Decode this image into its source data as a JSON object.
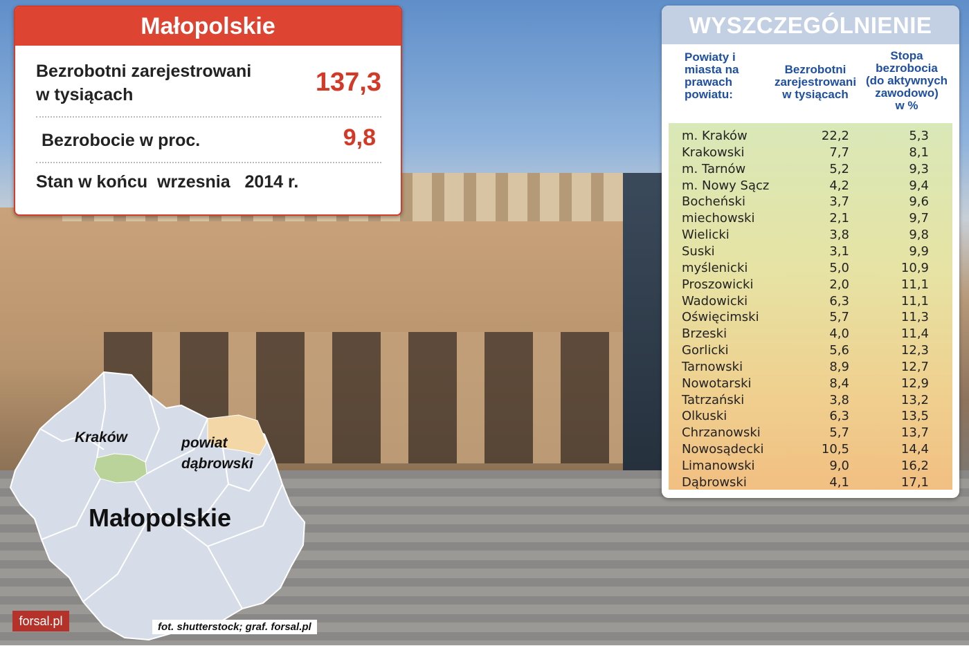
{
  "summary": {
    "title": "Małopolskie",
    "registered_label_line1": "Bezrobotni zarejestrowani",
    "registered_label_line2": "w tysiącach",
    "registered_value": "137,3",
    "rate_label": "Bezrobocie w proc.",
    "rate_value": "9,8",
    "status_label": "Stan w końcu  wrzesnia   2014 r."
  },
  "table": {
    "title": "WYSZCZEGÓLNIENIE",
    "headers": {
      "col1": [
        "Powiaty i",
        "miasta na",
        "prawach",
        "powiatu:"
      ],
      "col2": [
        "Bezrobotni",
        "zarejestrowani",
        "w tysiącach"
      ],
      "col3": [
        "Stopa",
        "bezrobocia",
        "(do aktywnych",
        "zawodowo)",
        "w %"
      ]
    },
    "rows": [
      {
        "name": "m. Kraków",
        "registered": "22,2",
        "rate": "5,3"
      },
      {
        "name": "Krakowski",
        "registered": "7,7",
        "rate": "8,1"
      },
      {
        "name": "m. Tarnów",
        "registered": "5,2",
        "rate": "9,3"
      },
      {
        "name": "m. Nowy Sącz",
        "registered": "4,2",
        "rate": "9,4"
      },
      {
        "name": "Bocheński",
        "registered": "3,7",
        "rate": "9,6"
      },
      {
        "name": "miechowski",
        "registered": "2,1",
        "rate": "9,7"
      },
      {
        "name": "Wielicki",
        "registered": "3,8",
        "rate": "9,8"
      },
      {
        "name": "Suski",
        "registered": "3,1",
        "rate": "9,9"
      },
      {
        "name": "myślenicki",
        "registered": "5,0",
        "rate": "10,9"
      },
      {
        "name": "Proszowicki",
        "registered": "2,0",
        "rate": "11,1"
      },
      {
        "name": "Wadowicki",
        "registered": "6,3",
        "rate": "11,1"
      },
      {
        "name": "Oświęcimski",
        "registered": "5,7",
        "rate": "11,3"
      },
      {
        "name": "Brzeski",
        "registered": "4,0",
        "rate": "11,4"
      },
      {
        "name": "Gorlicki",
        "registered": "5,6",
        "rate": "12,3"
      },
      {
        "name": "Tarnowski",
        "registered": "8,9",
        "rate": "12,7"
      },
      {
        "name": "Nowotarski",
        "registered": "8,4",
        "rate": "12,9"
      },
      {
        "name": "Tatrzański",
        "registered": "3,8",
        "rate": "13,2"
      },
      {
        "name": "Olkuski",
        "registered": "6,3",
        "rate": "13,5"
      },
      {
        "name": "Chrzanowski",
        "registered": "5,7",
        "rate": "13,7"
      },
      {
        "name": "Nowosądecki",
        "registered": "10,5",
        "rate": "14,4"
      },
      {
        "name": "Limanowski",
        "registered": "9,0",
        "rate": "16,2"
      },
      {
        "name": "Dąbrowski",
        "registered": "4,1",
        "rate": "17,1"
      }
    ]
  },
  "map": {
    "region_label": "Małopolskie",
    "city_label": "Kraków",
    "district_label_line1": "powiat",
    "district_label_line2": "dąbrowski",
    "colors": {
      "region": "#d7dde8",
      "krakow": "#b9d39a",
      "dabrowski": "#f3d7a6",
      "border": "#ffffff"
    }
  },
  "footer": {
    "logo": "forsal.pl",
    "credit": "fot. shutterstock; graf. forsal.pl"
  }
}
